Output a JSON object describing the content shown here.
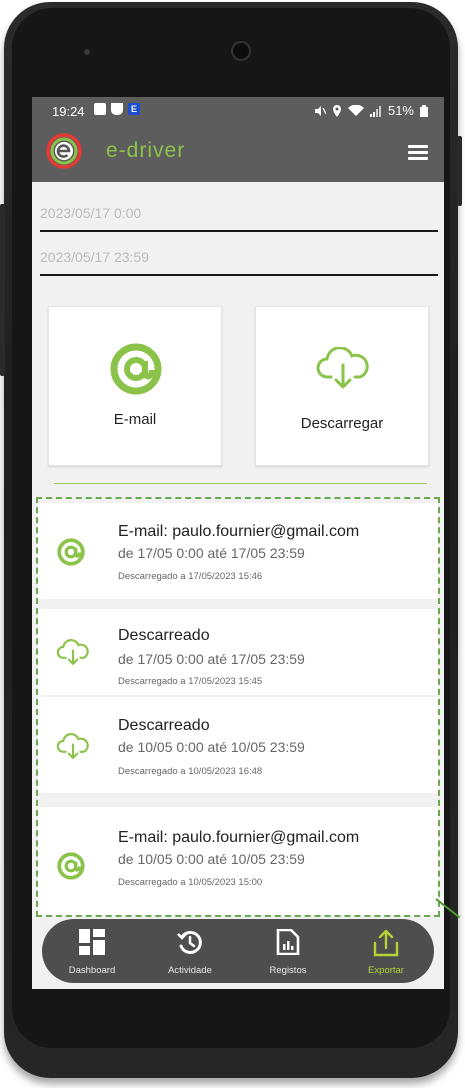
{
  "status_bar": {
    "time": "19:24",
    "battery": "51%"
  },
  "app": {
    "brand": "e-driver",
    "accent_color": "#8bc34a"
  },
  "filters": {
    "start_date": "2023/05/17 0:00",
    "end_date": "2023/05/17 23:59"
  },
  "export_options": {
    "email_label": "E-mail",
    "email_icon": "at-icon",
    "download_label": "Descarregar",
    "download_icon": "cloud-download-icon"
  },
  "history": [
    {
      "icon": "at-icon",
      "title": "E-mail: paulo.fournier@gmail.com",
      "range": "de 17/05 0:00 até 17/05 23:59",
      "meta": "Descarregado a 17/05/2023 15:46"
    },
    {
      "icon": "cloud-download-icon",
      "title": "Descarreado",
      "range": "de 17/05 0:00 até 17/05 23:59",
      "meta": "Descarregado a 17/05/2023 15:45"
    },
    {
      "icon": "cloud-download-icon",
      "title": "Descarreado",
      "range": "de 10/05 0:00 até 10/05 23:59",
      "meta": "Descarregado a 10/05/2023 16:48"
    },
    {
      "icon": "at-icon",
      "title": "E-mail: paulo.fournier@gmail.com",
      "range": "de 10/05 0:00 até 10/05 23:59",
      "meta": "Descarregado a 10/05/2023 15:00"
    }
  ],
  "nav": [
    {
      "label": "Dashboard",
      "icon": "dashboard-icon",
      "active": false
    },
    {
      "label": "Actividade",
      "icon": "history-icon",
      "active": false
    },
    {
      "label": "Registos",
      "icon": "report-icon",
      "active": false
    },
    {
      "label": "Exportar",
      "icon": "export-icon",
      "active": true
    }
  ]
}
